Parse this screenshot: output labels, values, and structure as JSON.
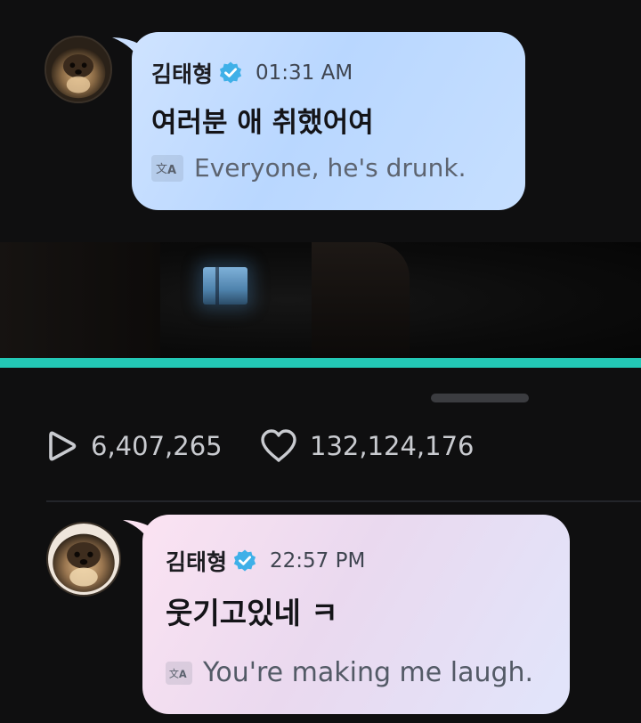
{
  "colors": {
    "background": "#0f0f10",
    "accent": "#23c8b6",
    "verified_badge": "#3fb0e8",
    "bubble_1": "#c4ddff",
    "bubble_2": "#ede0f2"
  },
  "messages": [
    {
      "sender": "김태형",
      "verified": true,
      "time": "01:31 AM",
      "text": "여러분 애 취했어여",
      "translation": "Everyone, he's drunk.",
      "avatar_icon": "pomeranian-avatar"
    },
    {
      "sender": "김태형",
      "verified": true,
      "time": "22:57 PM",
      "text": "웃기고있네 ㅋ",
      "translation": "You're making me laugh.",
      "avatar_icon": "pomeranian-avatar"
    }
  ],
  "video": {
    "progress": 1.0
  },
  "stats": {
    "plays": "6,407,265",
    "likes": "132,124,176",
    "plays_icon": "play-icon",
    "likes_icon": "heart-icon"
  },
  "icons": {
    "translate": "translate-icon",
    "verified": "verified-badge-icon"
  }
}
